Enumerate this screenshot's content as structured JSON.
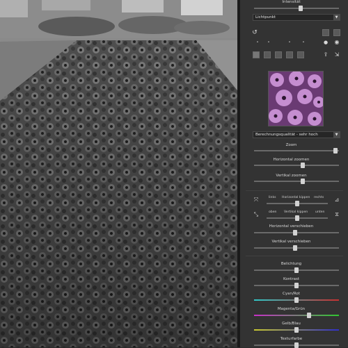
{
  "panel": {
    "intensity_label": "Intensität",
    "mode_dropdown": "Lichtpunkt",
    "quality_dropdown": "Berechnungsqualität - sehr hoch",
    "zoom_label": "Zoom",
    "hzoom_label": "Horizontal zoomen",
    "vzoom_label": "Vertikal zoomen",
    "flip_h": {
      "left": "links",
      "label": "Horizontal kippen",
      "right": "rechts"
    },
    "flip_v": {
      "left": "oben",
      "label": "Vertikal kippen",
      "right": "unten"
    },
    "hshift_label": "Horizontal verschieben",
    "vshift_label": "Vertikal verschieben",
    "exposure_label": "Belichtung",
    "contrast_label": "Kontrast",
    "cyan_label": "Cyan/Rot",
    "magenta_label": "Magenta/Grün",
    "yellow_label": "Gelb/Blau",
    "texture_label": "Texturfarbe",
    "sliders": {
      "intensity": 0.55,
      "zoom": 0.96,
      "hzoom": 0.57,
      "vzoom": 0.57,
      "hshift": 0.48,
      "vshift": 0.48,
      "exposure": 0.5,
      "contrast": 0.5,
      "cyan": 0.5,
      "magenta": 0.65,
      "yellow": 0.5,
      "texture": 0.5
    },
    "colors": {
      "cyan_red": [
        "#30c8c8",
        "#c83030"
      ],
      "magenta_green": [
        "#c830c8",
        "#30c830"
      ],
      "yellow_blue": [
        "#c8c830",
        "#3030c8"
      ],
      "texture_preview": "#b27bbf"
    }
  }
}
